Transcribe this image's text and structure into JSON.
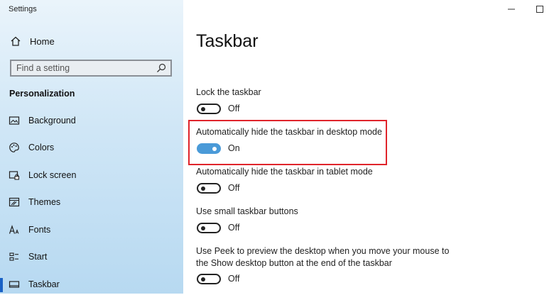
{
  "window": {
    "title": "Settings",
    "controls": [
      "minimize-icon",
      "maximize-icon"
    ]
  },
  "sidebar": {
    "home_label": "Home",
    "search_placeholder": "Find a setting",
    "section_title": "Personalization",
    "items": [
      {
        "label": "Background",
        "icon": "background-icon"
      },
      {
        "label": "Colors",
        "icon": "palette-icon"
      },
      {
        "label": "Lock screen",
        "icon": "lock-screen-icon"
      },
      {
        "label": "Themes",
        "icon": "themes-icon"
      },
      {
        "label": "Fonts",
        "icon": "fonts-icon"
      },
      {
        "label": "Start",
        "icon": "start-icon"
      },
      {
        "label": "Taskbar",
        "icon": "taskbar-icon",
        "selected": true
      }
    ]
  },
  "main": {
    "title": "Taskbar",
    "settings": [
      {
        "label": "Lock the taskbar",
        "state": "Off",
        "on": false
      },
      {
        "label": "Automatically hide the taskbar in desktop mode",
        "state": "On",
        "on": true,
        "highlighted": true
      },
      {
        "label": "Automatically hide the taskbar in tablet mode",
        "state": "Off",
        "on": false
      },
      {
        "label": "Use small taskbar buttons",
        "state": "Off",
        "on": false
      },
      {
        "label_line1": "Use Peek to preview the desktop when you move your mouse to",
        "label_line2": "the Show desktop button at the end of the taskbar",
        "state": "Off",
        "on": false
      }
    ]
  },
  "colors": {
    "accent": "#4a9ad8",
    "highlight_border": "#e0242b",
    "selected_bar": "#1a62c6"
  }
}
